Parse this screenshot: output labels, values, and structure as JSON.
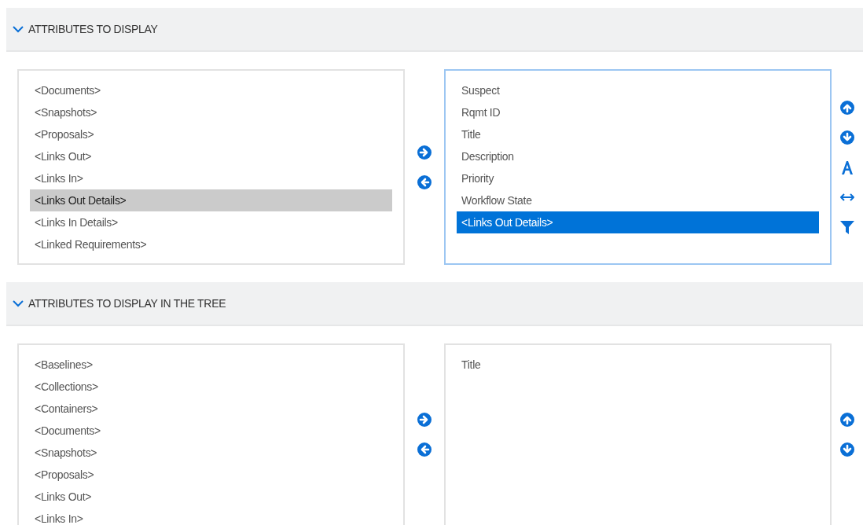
{
  "sections": [
    {
      "title": "ATTRIBUTES TO DISPLAY",
      "expanded": true,
      "available": [
        {
          "label": "<Documents>",
          "selected": false
        },
        {
          "label": "<Snapshots>",
          "selected": false
        },
        {
          "label": "<Proposals>",
          "selected": false
        },
        {
          "label": "<Links Out>",
          "selected": false
        },
        {
          "label": "<Links In>",
          "selected": false
        },
        {
          "label": "<Links Out Details>",
          "selected": true
        },
        {
          "label": "<Links In Details>",
          "selected": false
        },
        {
          "label": "<Linked Requirements>",
          "selected": false
        }
      ],
      "chosen_focused": true,
      "chosen": [
        {
          "label": "Suspect",
          "selected": false
        },
        {
          "label": "Rqmt ID",
          "selected": false
        },
        {
          "label": "Title",
          "selected": false
        },
        {
          "label": "Description",
          "selected": false
        },
        {
          "label": "Priority",
          "selected": false
        },
        {
          "label": "Workflow State",
          "selected": false
        },
        {
          "label": "<Links Out Details>",
          "selected": true
        }
      ],
      "tools": [
        {
          "kind": "up"
        },
        {
          "kind": "down"
        },
        {
          "kind": "font"
        },
        {
          "kind": "width"
        },
        {
          "kind": "filter"
        }
      ]
    },
    {
      "title": "ATTRIBUTES TO DISPLAY IN THE TREE",
      "expanded": true,
      "available": [
        {
          "label": "<Baselines>",
          "selected": false
        },
        {
          "label": "<Collections>",
          "selected": false
        },
        {
          "label": "<Containers>",
          "selected": false
        },
        {
          "label": "<Documents>",
          "selected": false
        },
        {
          "label": "<Snapshots>",
          "selected": false
        },
        {
          "label": "<Proposals>",
          "selected": false
        },
        {
          "label": "<Links Out>",
          "selected": false
        },
        {
          "label": "<Links In>",
          "selected": false
        }
      ],
      "chosen_focused": false,
      "chosen": [
        {
          "label": "Title",
          "selected": false
        }
      ],
      "tools": [
        {
          "kind": "up"
        },
        {
          "kind": "down"
        }
      ]
    }
  ]
}
